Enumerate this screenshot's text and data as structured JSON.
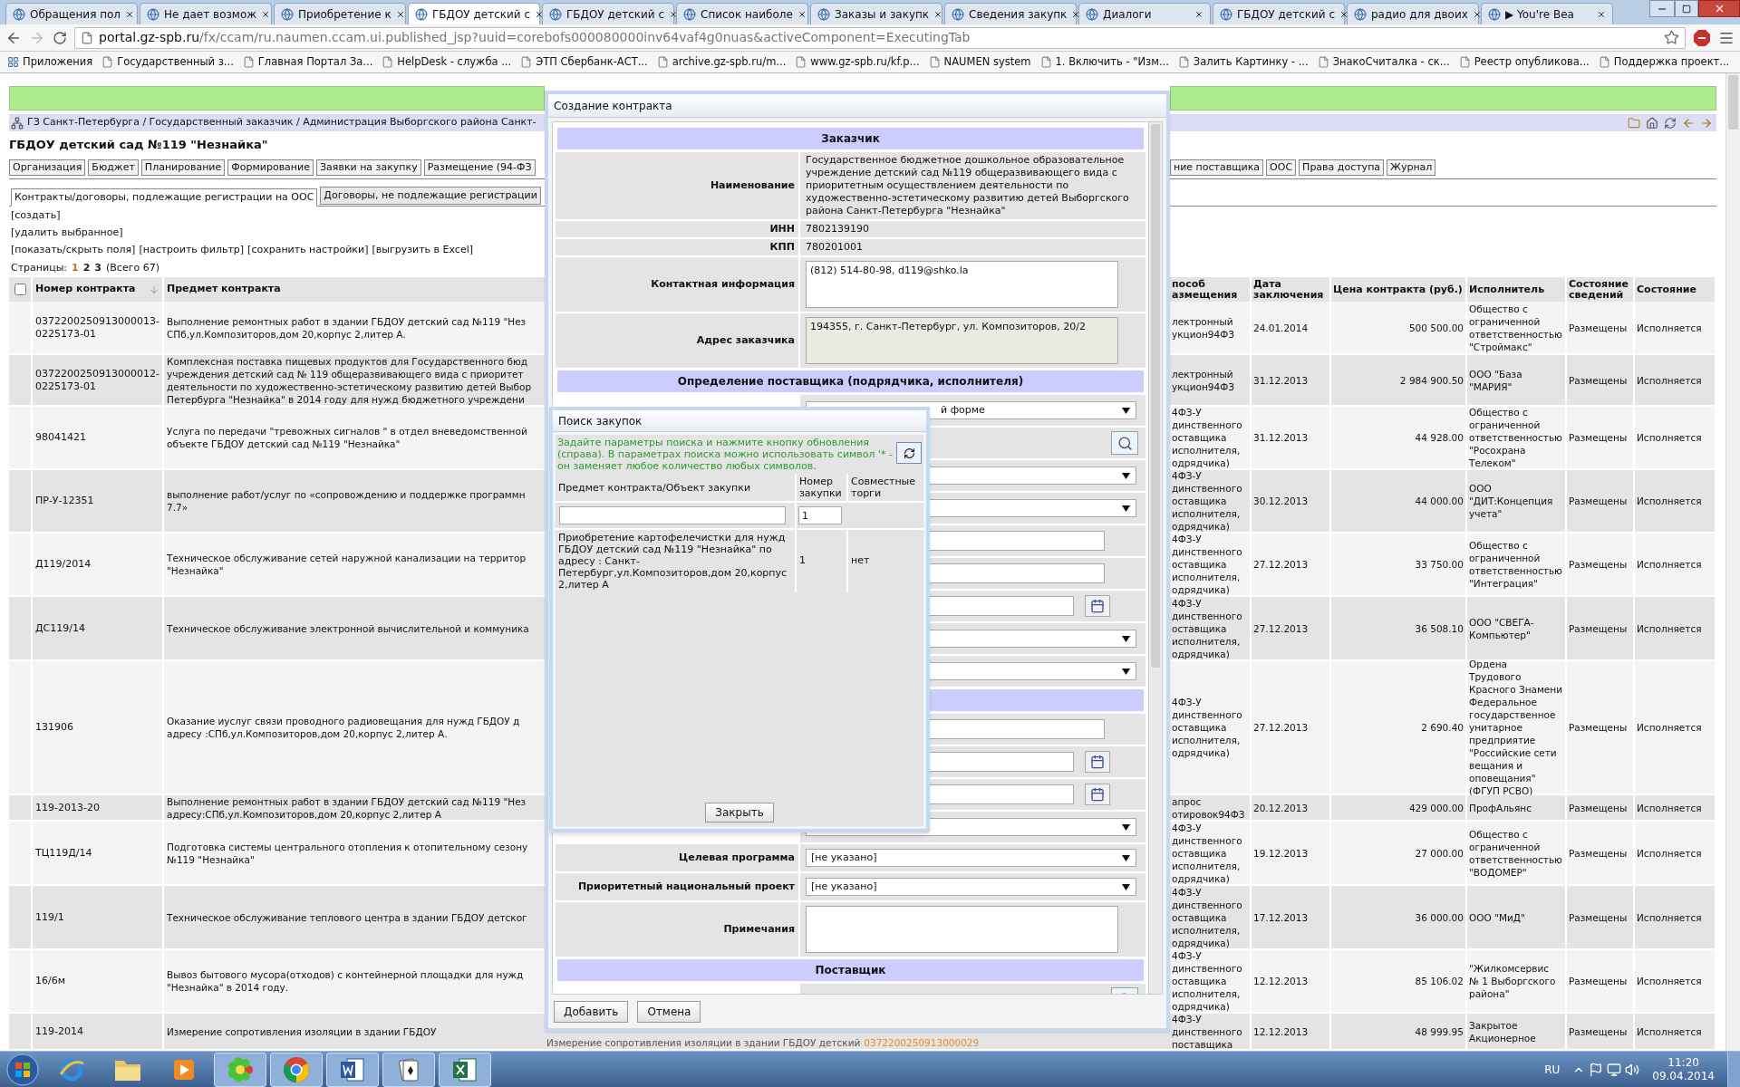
{
  "browser": {
    "tabs": [
      {
        "title": "Обращения пол",
        "selected": false
      },
      {
        "title": "Не дает возмож",
        "selected": false
      },
      {
        "title": "Приобретение к",
        "selected": false
      },
      {
        "title": "ГБДОУ детский с",
        "selected": true
      },
      {
        "title": "ГБДОУ детский с",
        "selected": false
      },
      {
        "title": "Список наиболе",
        "selected": false
      },
      {
        "title": "Заказы и закупк",
        "selected": false
      },
      {
        "title": "Сведения закупк",
        "selected": false
      },
      {
        "title": "Диалоги",
        "selected": false
      },
      {
        "title": "ГБДОУ детский с",
        "selected": false
      },
      {
        "title": "радио для двоих",
        "selected": false
      },
      {
        "title": "▶ You're Bea",
        "selected": false
      }
    ],
    "address": {
      "host": "portal.gz-spb.ru",
      "path": "/fx/ccam/ru.naumen.ccam.ui.published_jsp?uuid=corebofs000080000inv64vaf4g0nuas&activeComponent=ExecutingTab"
    },
    "bookmarks": [
      "Приложения",
      "Государственный з...",
      "Главная Портал За...",
      "HelpDesk - служба ...",
      "ЭТП Сбербанк-АСТ...",
      "archive.gz-spb.ru/m...",
      "www.gz-spb.ru/kf.p...",
      "NAUMEN system",
      "1. Включить - \"Изм...",
      "Залить Картинку - ...",
      "ЗнакоСчиталка - ск...",
      "Реестр опубликова...",
      "Поддержка проект..."
    ]
  },
  "page": {
    "breadcrumb": "ГЗ Санкт-Петербурга / Государственный заказчик / Администрация Выборгского района Санкт-",
    "title": "ГБДОУ детский сад №119 \"Незнайка\"",
    "nav_tabs_left": [
      "Организация",
      "Бюджет",
      "Планирование",
      "Формирование",
      "Заявки на закупку",
      "Размещение (94-ФЗ"
    ],
    "nav_tabs_right": [
      "ние поставщика",
      "ООС",
      "Права доступа",
      "Журнал"
    ],
    "sub_tabs": [
      {
        "label": "Контракты/договоры, подлежащие регистрации на ООС",
        "selected": true
      },
      {
        "label": "Договоры, не подлежащие регистрации",
        "selected": false
      }
    ],
    "actions": [
      [
        "[создать]"
      ],
      [
        "[удалить выбранное]"
      ],
      [
        "[показать/скрыть поля]",
        "[настроить фильтр]",
        "[сохранить настройки]",
        "[выгрузить в Excel]"
      ]
    ],
    "pager": {
      "label": "Страницы:",
      "pages": [
        {
          "label": "1",
          "selected": true
        },
        {
          "label": "2",
          "selected": false
        },
        {
          "label": "3",
          "selected": false
        }
      ],
      "total": "(Всего 67)"
    }
  },
  "table": {
    "select_all": {
      "checked": false
    },
    "columns_left": [
      "Номер контракта",
      "Предмет контракта"
    ],
    "columns_right": [
      "пособ\nазмещения",
      "Дата\nзаключения",
      "Цена контракта (руб.)",
      "Исполнитель",
      "Состояние\nсведений",
      "Состояние"
    ],
    "rows": [
      {
        "number": "0372200250913000013-\n0225173-01",
        "subject": "Выполнение ремонтных работ в здании ГБДОУ детский сад №119 \"Нез\nСПб,ул.Композиторов,дом 20,корпус 2,литер А.",
        "method": "лектронный\nукцион94ФЗ",
        "date": "24.01.2014",
        "price": "500 500.00",
        "executor": "Общество с\nограниченной\nответственностью\n\"Строймакс\"",
        "info_state": "Размещены",
        "state": "Исполняется"
      },
      {
        "number": "0372200250913000012-\n0225173-01",
        "subject": "Комплексная поставка пищевых продуктов для Государственного бюд\nучреждения детский сад № 119 общеразвивающего вида с приоритет\nдеятельности по художественно-эстетическому развитию детей Выбор\nПетербурга \"Незнайка\" в 2014 году для нужд бюджетного учреждени",
        "method": "лектронный\nукцион94ФЗ",
        "date": "31.12.2013",
        "price": "2 984 900.50",
        "executor": "ООО \"База\n\"МАРИЯ\"",
        "info_state": "Размещены",
        "state": "Исполняется"
      },
      {
        "number": "98041421",
        "subject": "Услуга по передачи \"тревожных сигналов \" в отдел вневедомственной\nобъекте ГБДОУ детский сад №119 \"Незнайка\"",
        "method": "4ФЗ-У\nдинственного\nоставщика\nисполнителя,\nодрядчика)",
        "date": "31.12.2013",
        "price": "44 928.00",
        "executor": "Общество с\nограниченной\nответственностью\n\"Росохрана\nТелеком\"",
        "info_state": "Размещены",
        "state": "Исполняется"
      },
      {
        "number": "ПР-У-12351",
        "subject": "выполнение работ/услуг по «сопровождению и поддержке программн\n7.7»",
        "method": "4ФЗ-У\nдинственного\nоставщика\nисполнителя,\nодрядчика)",
        "date": "30.12.2013",
        "price": "44 000.00",
        "executor": "ООО\n\"ДИТ:Концепция\nучета\"",
        "info_state": "Размещены",
        "state": "Исполняется"
      },
      {
        "number": "Д119/2014",
        "subject": "Техническое обслуживание сетей наружной канализации на территор\n\"Незнайка\"",
        "method": "4ФЗ-У\nдинственного\nоставщика\nисполнителя,\nодрядчика)",
        "date": "27.12.2013",
        "price": "33 750.00",
        "executor": "Общество с\nограниченной\nответственностью\n\"Интеграция\"",
        "info_state": "Размещены",
        "state": "Исполняется"
      },
      {
        "number": "ДС119/14",
        "subject": "Техническое обслуживание электронной вычислительной и коммуника",
        "method": "4ФЗ-У\nдинственного\nоставщика\nисполнителя,\nодрядчика)",
        "date": "27.12.2013",
        "price": "36 508.10",
        "executor": "ООО \"СВЕГА-\nКомпьютер\"",
        "info_state": "Размещены",
        "state": "Исполняется"
      },
      {
        "number": "131906",
        "subject": "Оказание иуслуг связи проводного радиовещания для нужд ГБДОУ д\nадресу :СПб,ул.Композиторов,дом 20,корпус 2,литер А.",
        "method": "4ФЗ-У\nдинственного\nоставщика\nисполнителя,\nодрядчика)",
        "date": "27.12.2013",
        "price": "2 690.40",
        "executor": "Ордена\nТрудового\nКрасного Знамени\nФедеральное\nгосударственное\nунитарное\nпредприятие\n\"Российские сети\nвещания и\nоповещания\"\n(ФГУП РСВО)",
        "info_state": "Размещены",
        "state": "Исполняется"
      },
      {
        "number": "119-2013-20",
        "subject": "Выполнение ремонтных работ в здании ГБДОУ детский сад №119 \"Нез\nадресу:СПб,ул.Композиторов,дом 20,корпус 2,литер А",
        "method": "апрос\nотировок94ФЗ",
        "date": "20.12.2013",
        "price": "429 000.00",
        "executor": "ПрофАльянс",
        "info_state": "Размещены",
        "state": "Исполняется"
      },
      {
        "number": "ТЦ119Д/14",
        "subject": "Подготовка системы центрального отопления к отопительному сезону\n№119 \"Незнайка\"",
        "method": "4ФЗ-У\nдинственного\nоставщика\nисполнителя,\nодрядчика)",
        "date": "19.12.2013",
        "price": "27 000.00",
        "executor": "Общество с\nограниченной\nответственностью\n\"ВОДОМЕР\"",
        "info_state": "Размещены",
        "state": "Исполняется"
      },
      {
        "number": "119/1",
        "subject": "Техническое обслуживание теплового центра в здании ГБДОУ детског",
        "method": "4ФЗ-У\nдинственного\nоставщика\nисполнителя,\nодрядчика)",
        "date": "17.12.2013",
        "price": "36 000.00",
        "executor": "ООО \"МиД\"",
        "info_state": "Размещены",
        "state": "Исполняется"
      },
      {
        "number": "16/6м",
        "subject": "Вывоз бытового мусора(отходов) с контейнерной площадки для нужд\n\"Незнайка\" в 2014 году.",
        "method": "4ФЗ-У\nдинственного\nоставщика\nисполнителя,\nодрядчика)",
        "date": "12.12.2013",
        "price": "85 106.02",
        "executor": "\"Жилкомсервис\n№ 1 Выборгского\nрайона\"",
        "info_state": "Размещены",
        "state": "Исполняется"
      },
      {
        "number": "119-2014",
        "subject": "Измерение сопротивления изоляции в здании ГБДОУ",
        "hidden_subject": "Измерение сопротивления изоляции в здании ГБДОУ детский",
        "procurement_number": "0372200250913000029",
        "method": "4ФЗ-У\nдинственного\nпоставщика",
        "date": "12.12.2013",
        "price": "48 999.95",
        "executor": "Закрытое\nАкционерное",
        "info_state": "Размещены",
        "state": "Исполняется"
      }
    ]
  },
  "dialog": {
    "title": "Создание контракта",
    "rows": [
      {
        "kind": "section",
        "label": "Заказчик"
      },
      {
        "kind": "text",
        "label": "Наименование",
        "value": "Государственное бюджетное дошкольное образовательное учреждение детский сад №119 общеразвивающего вида с приоритетным осуществлением деятельности по художественно-эстетическому развитию детей Выборгского района Санкт-Петербурга \"Незнайка\""
      },
      {
        "kind": "text",
        "label": "ИНН",
        "value": "7802139190"
      },
      {
        "kind": "text",
        "label": "КПП",
        "value": "780201001"
      },
      {
        "kind": "textarea",
        "label": "Контактная информация",
        "value": "(812) 514-80-98, d119@shko.la",
        "disabled": false
      },
      {
        "kind": "textarea",
        "label": "Адрес заказчика",
        "value": "194355, г. Санкт-Петербург, ул. Композиторов, 20/2",
        "disabled": true
      },
      {
        "kind": "section",
        "label": "Определение поставщика (подрядчика, исполнителя)"
      },
      {
        "kind": "select",
        "value": "й форме"
      },
      {
        "kind": "lookup"
      },
      {
        "kind": "select"
      },
      {
        "kind": "select"
      },
      {
        "kind": "input"
      },
      {
        "kind": "input"
      },
      {
        "kind": "date"
      },
      {
        "kind": "select"
      },
      {
        "kind": "select"
      },
      {
        "kind": "section"
      },
      {
        "kind": "input"
      },
      {
        "kind": "date"
      },
      {
        "kind": "date"
      },
      {
        "kind": "select"
      },
      {
        "kind": "select",
        "label": "Целевая программа",
        "value": "[не указано]"
      },
      {
        "kind": "select",
        "label": "Приоритетный национальный проект",
        "value": "[не указано]"
      },
      {
        "kind": "textarea",
        "label": "Примечания",
        "value": "",
        "disabled": false
      },
      {
        "kind": "section",
        "label": "Поставщик"
      },
      {
        "kind": "lookup"
      }
    ],
    "buttons": [
      "Добавить",
      "Отмена"
    ]
  },
  "search_dialog": {
    "title": "Поиск закупок",
    "hint": "Задайте параметры поиска и нажмите кнопку обновления (справа). В параметрах поиска можно использовать символ '* - он заменяет любое количество любых символов.",
    "columns": [
      "Предмет контракта/Объект закупки",
      "Номер\nзакупки",
      "Совместные\nторги"
    ],
    "filter_number": "1",
    "results": [
      {
        "subject": "Приобретение картофелечистки для нужд ГБДОУ детский сад №119 \"Незнайка\" по адресу : Санкт-Петербург,ул.Композиторов,дом 20,корпус 2,литер А",
        "number": "1",
        "joint": "нет"
      }
    ],
    "close_button": "Закрыть"
  },
  "taskbar": {
    "apps": [
      {
        "kind": "ie",
        "running": false
      },
      {
        "kind": "folder",
        "running": false
      },
      {
        "kind": "media",
        "running": false
      },
      {
        "kind": "icq",
        "running": true
      },
      {
        "kind": "chrome",
        "running": true
      },
      {
        "kind": "word",
        "running": true
      },
      {
        "kind": "cards",
        "running": true
      },
      {
        "kind": "excel",
        "running": true
      }
    ],
    "language": "RU",
    "time": "11:20",
    "date": "09.04.2014"
  }
}
